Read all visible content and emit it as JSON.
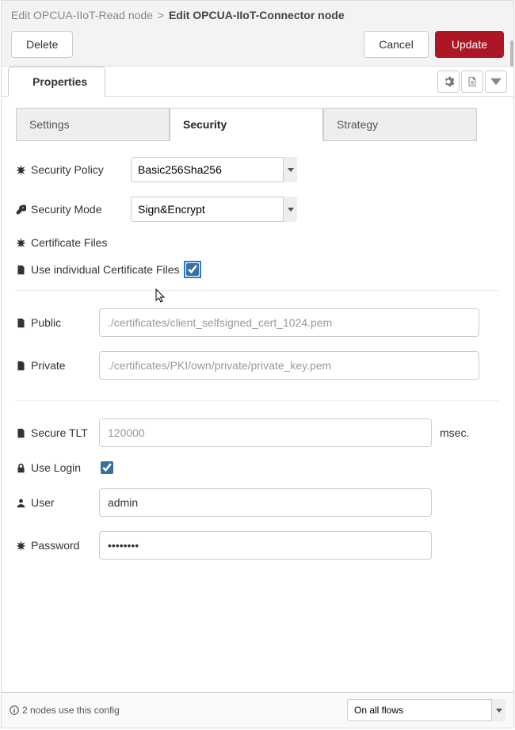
{
  "breadcrumb": {
    "prev": "Edit OPCUA-IIoT-Read node",
    "sep": ">",
    "current": "Edit OPCUA-IIoT-Connector node"
  },
  "actions": {
    "delete": "Delete",
    "cancel": "Cancel",
    "update": "Update"
  },
  "propTab": {
    "label": "Properties"
  },
  "subtabs": {
    "settings": "Settings",
    "security": "Security",
    "strategy": "Strategy"
  },
  "fields": {
    "securityPolicy": {
      "label": "Security Policy",
      "value": "Basic256Sha256"
    },
    "securityMode": {
      "label": "Security Mode",
      "value": "Sign&Encrypt"
    },
    "certFiles": {
      "label": "Certificate Files"
    },
    "individual": {
      "label": "Use individual Certificate Files",
      "checked": true
    },
    "public": {
      "label": "Public",
      "placeholder": "./certificates/client_selfsigned_cert_1024.pem",
      "value": ""
    },
    "private": {
      "label": "Private",
      "placeholder": "./certificates/PKI/own/private/private_key.pem",
      "value": ""
    },
    "secureTLT": {
      "label": "Secure TLT",
      "placeholder": "120000",
      "value": "",
      "unit": "msec."
    },
    "useLogin": {
      "label": "Use Login",
      "checked": true
    },
    "user": {
      "label": "User",
      "value": "admin"
    },
    "password": {
      "label": "Password",
      "value": "••••••••"
    }
  },
  "footer": {
    "usage": "2 nodes use this config",
    "scope": "On all flows"
  }
}
